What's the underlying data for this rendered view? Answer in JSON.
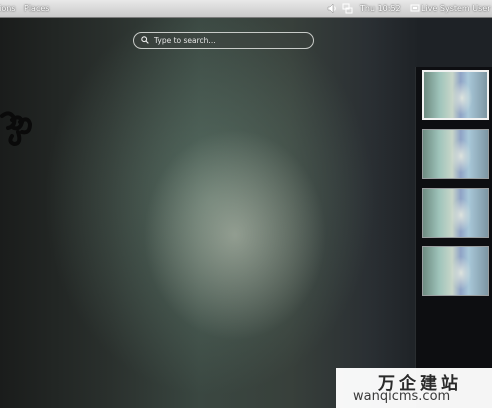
{
  "topbar": {
    "activities_label": "tions",
    "places_label": "Places",
    "volume_icon": "volume-icon",
    "network_icon": "network-icon",
    "clock": "Thu 10:52",
    "user_icon": "user-icon",
    "user_label": "Live System User"
  },
  "search": {
    "placeholder": "Type to search...",
    "icon": "search-icon"
  },
  "workspaces": {
    "count": 4,
    "selected_index": 0
  },
  "watermark": {
    "chinese": "万企建站",
    "url": "wanqicms.com"
  },
  "colors": {
    "topbar": "#d8d8d8",
    "panel": "#0c0e10",
    "thumb_border_selected": "#f2f2f2"
  }
}
